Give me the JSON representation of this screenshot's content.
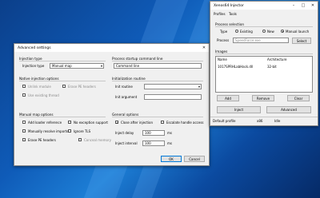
{
  "advanced": {
    "title": "Advanced settings",
    "injection_type": {
      "heading": "Injection type",
      "label": "Injection type",
      "value": "Manual map"
    },
    "native_options": {
      "heading": "Native injection options",
      "unlink_module": "Unlink module",
      "erase_pe_headers": "Erase PE headers",
      "use_existing_thread": "Use existing thread"
    },
    "manual_map_options": {
      "heading": "Manual map options",
      "add_loader_reference": "Add loader reference",
      "no_exception_support": "No exception support",
      "manually_resolve_imports": "Manually resolve imports",
      "ignore_tls": "Ignore TLS",
      "erase_pe_headers": "Erase PE headers",
      "conceal_memory": "Conceal memory"
    },
    "process_cmdline": {
      "heading": "Process startup command line",
      "value": "Command line"
    },
    "init_routine": {
      "heading": "Initialization routine",
      "routine_label": "Init routine",
      "argument_label": "Init argument"
    },
    "general_options": {
      "heading": "General options",
      "close_after_injection": "Close after injection",
      "escalate_handle_access": "Escalate handle access",
      "injection_delay_label": "Inject delay",
      "injection_delay_value": "100",
      "injection_interval_label": "Inject interval",
      "injection_interval_value": "100",
      "unit": "ms"
    },
    "ok": "OK",
    "cancel": "Cancel"
  },
  "main": {
    "title": "Xenos64 Injector",
    "menu": [
      "Profiles",
      "Tools"
    ],
    "process_selection": {
      "heading": "Process selection",
      "type_label": "Type",
      "existing": "Existing",
      "new": "New",
      "manual_launch": "Manual launch",
      "process_label": "Process",
      "process_value": "SpeedForce.exe",
      "select": "Select"
    },
    "images": {
      "heading": "Images",
      "col_name": "Name",
      "col_arch": "Architecture",
      "rows": [
        {
          "name": "1017SPRHLabHack.dll",
          "arch": "32-bit"
        }
      ]
    },
    "add": "Add",
    "remove": "Remove",
    "clear": "Clear",
    "inject": "Inject",
    "advanced_btn": "Advanced",
    "status": {
      "profile": "Default profile",
      "arch": "x86",
      "state": "Idle"
    }
  },
  "colors": {
    "desktop": "#0f5bb8",
    "window_bg": "#f0f0f0",
    "accent": "#0078d7"
  }
}
